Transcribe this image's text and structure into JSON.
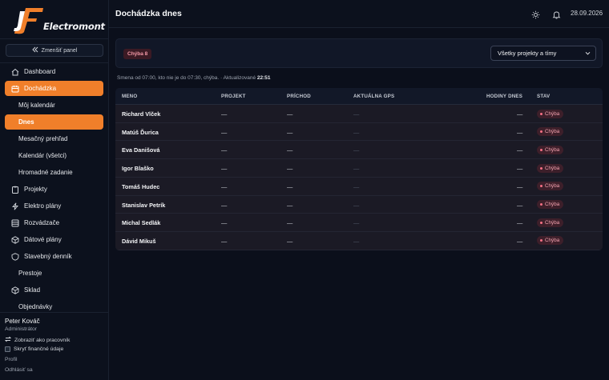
{
  "brand": {
    "name": "Electromont"
  },
  "sidebar": {
    "collapse_label": "Zmenšiť panel",
    "items": [
      {
        "label": "Dashboard",
        "icon": "home-icon"
      },
      {
        "label": "Dochádzka",
        "icon": "calendar-icon"
      },
      {
        "label": "Môj kalendár"
      },
      {
        "label": "Dnes"
      },
      {
        "label": "Mesačný prehľad"
      },
      {
        "label": "Kalendár (všetci)"
      },
      {
        "label": "Hromadné zadanie"
      },
      {
        "label": "Projekty",
        "icon": "clipboard-icon"
      },
      {
        "label": "Elektro plány",
        "icon": "lightning-icon"
      },
      {
        "label": "Rozvádzače",
        "icon": "server-icon"
      },
      {
        "label": "Dátové plány",
        "icon": "box-icon"
      },
      {
        "label": "Stavebný denník",
        "icon": "shield-icon"
      },
      {
        "label": "Prestoje"
      },
      {
        "label": "Sklad",
        "icon": "box-icon"
      },
      {
        "label": "Objednávky"
      }
    ]
  },
  "user": {
    "name": "Peter Kováč",
    "role": "Administrátor",
    "view_as_worker": "Zobraziť ako pracovník",
    "hide_finance": "Skryť finančné údaje",
    "profile": "Profil",
    "logout": "Odhlásiť sa"
  },
  "header": {
    "title": "Dochádzka dnes",
    "date": "28.09.2026"
  },
  "filter": {
    "error_badge": "Chýba 8",
    "select_value": "Všetky projekty a tímy"
  },
  "info": {
    "text": "Smena od 07:00, kto nie je do 07:30, chýba. · Aktualizované",
    "time": "22:51"
  },
  "table": {
    "columns": [
      "MENO",
      "PROJEKT",
      "PRÍCHOD",
      "AKTUÁLNA GPS",
      "HODINY DNES",
      "STAV"
    ],
    "rows": [
      {
        "name": "Richard Vlček",
        "project": "—",
        "arrival": "—",
        "gps": "—",
        "hours": "—",
        "status": "Chýba"
      },
      {
        "name": "Matúš Ďurica",
        "project": "—",
        "arrival": "—",
        "gps": "—",
        "hours": "—",
        "status": "Chýba"
      },
      {
        "name": "Eva Danišová",
        "project": "—",
        "arrival": "—",
        "gps": "—",
        "hours": "—",
        "status": "Chýba"
      },
      {
        "name": "Igor Blaško",
        "project": "—",
        "arrival": "—",
        "gps": "—",
        "hours": "—",
        "status": "Chýba"
      },
      {
        "name": "Tomáš Hudec",
        "project": "—",
        "arrival": "—",
        "gps": "—",
        "hours": "—",
        "status": "Chýba"
      },
      {
        "name": "Stanislav Petrík",
        "project": "—",
        "arrival": "—",
        "gps": "—",
        "hours": "—",
        "status": "Chýba"
      },
      {
        "name": "Michal Sedlák",
        "project": "—",
        "arrival": "—",
        "gps": "—",
        "hours": "—",
        "status": "Chýba"
      },
      {
        "name": "Dávid Mikuš",
        "project": "—",
        "arrival": "—",
        "gps": "—",
        "hours": "—",
        "status": "Chýba"
      }
    ]
  },
  "colors": {
    "accent": "#f07f2a",
    "error": "#f87185",
    "background": "#0b0f1b"
  }
}
